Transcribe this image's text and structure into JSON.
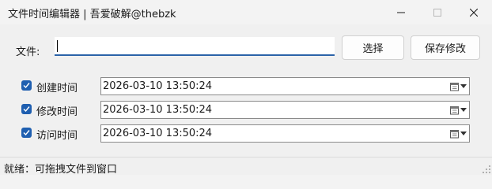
{
  "window": {
    "title": "文件时间编辑器 | 吾爱破解@thebzk"
  },
  "file": {
    "label": "文件:",
    "value": ""
  },
  "buttons": {
    "choose": "选择",
    "save": "保存修改"
  },
  "times": [
    {
      "label": "创建时间",
      "checked": true,
      "value": "2026-03-10 13:50:24"
    },
    {
      "label": "修改时间",
      "checked": true,
      "value": "2026-03-10 13:50:24"
    },
    {
      "label": "访问时间",
      "checked": true,
      "value": "2026-03-10 13:50:24"
    }
  ],
  "status": {
    "text": "就绪：可拖拽文件到窗口"
  },
  "icons": {
    "minimize": "minimize-icon",
    "maximize": "maximize-icon",
    "close": "close-icon",
    "checkbox": "checkmark-icon",
    "calendar": "calendar-icon",
    "dropdown": "chevron-down-icon",
    "grip": "resize-grip-icon"
  },
  "colors": {
    "accent": "#1f5fb0",
    "focus_underline": "#2b63a8"
  }
}
